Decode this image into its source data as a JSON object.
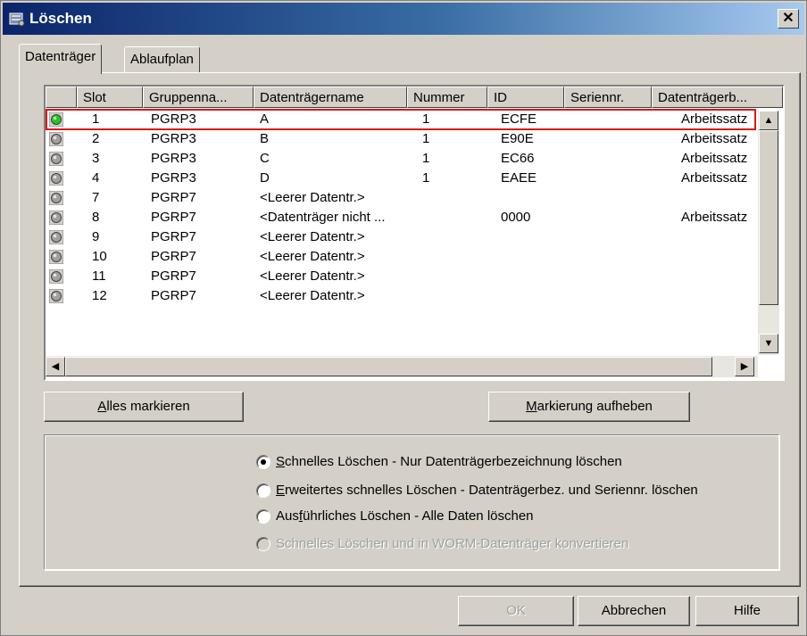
{
  "window": {
    "title": "Löschen",
    "close_glyph": "✕"
  },
  "tabs": [
    {
      "label": "Datenträger",
      "active": true
    },
    {
      "label": "Ablaufplan",
      "active": false
    }
  ],
  "table": {
    "columns": [
      "",
      "Slot",
      "Gruppenna...",
      "Datenträgername",
      "Nummer",
      "ID",
      "Seriennr.",
      "Datenträgerb..."
    ],
    "rows": [
      {
        "status": "green",
        "slot": "1",
        "group": "PGRP3",
        "name": "A",
        "nummer": "1",
        "id": "ECFE",
        "serial": "",
        "desc": "Arbeitssatz"
      },
      {
        "status": "gray",
        "slot": "2",
        "group": "PGRP3",
        "name": "B",
        "nummer": "1",
        "id": "E90E",
        "serial": "",
        "desc": "Arbeitssatz"
      },
      {
        "status": "gray",
        "slot": "3",
        "group": "PGRP3",
        "name": "C",
        "nummer": "1",
        "id": "EC66",
        "serial": "",
        "desc": "Arbeitssatz"
      },
      {
        "status": "gray",
        "slot": "4",
        "group": "PGRP3",
        "name": "D",
        "nummer": "1",
        "id": "EAEE",
        "serial": "",
        "desc": "Arbeitssatz"
      },
      {
        "status": "gray",
        "slot": "7",
        "group": "PGRP7",
        "name": "<Leerer Datentr.>",
        "nummer": "",
        "id": "",
        "serial": "",
        "desc": ""
      },
      {
        "status": "gray",
        "slot": "8",
        "group": "PGRP7",
        "name": "<Datenträger nicht ...",
        "nummer": "",
        "id": "0000",
        "serial": "",
        "desc": "Arbeitssatz"
      },
      {
        "status": "gray",
        "slot": "9",
        "group": "PGRP7",
        "name": "<Leerer Datentr.>",
        "nummer": "",
        "id": "",
        "serial": "",
        "desc": ""
      },
      {
        "status": "gray",
        "slot": "10",
        "group": "PGRP7",
        "name": "<Leerer Datentr.>",
        "nummer": "",
        "id": "",
        "serial": "",
        "desc": ""
      },
      {
        "status": "gray",
        "slot": "11",
        "group": "PGRP7",
        "name": "<Leerer Datentr.>",
        "nummer": "",
        "id": "",
        "serial": "",
        "desc": ""
      },
      {
        "status": "gray",
        "slot": "12",
        "group": "PGRP7",
        "name": "<Leerer Datentr.>",
        "nummer": "",
        "id": "",
        "serial": "",
        "desc": ""
      }
    ]
  },
  "buttons": {
    "select_all": {
      "accel": "A",
      "rest": "lles markieren"
    },
    "deselect": {
      "accel": "M",
      "rest": "arkierung aufheben"
    },
    "ok": "OK",
    "cancel": "Abbrechen",
    "help": "Hilfe"
  },
  "options": [
    {
      "accel": "S",
      "rest": "chnelles Löschen - Nur Datenträgerbezeichnung löschen",
      "checked": true,
      "disabled": false
    },
    {
      "accel": "E",
      "rest": "rweitertes schnelles Löschen - Datenträgerbez. und Seriennr. löschen",
      "checked": false,
      "disabled": false
    },
    {
      "pre": "Aus",
      "accel": "f",
      "rest": "ührliches Löschen - Alle Daten löschen",
      "checked": false,
      "disabled": false
    },
    {
      "pre": "",
      "accel": "",
      "rest": "Schnelles Löschen und in WORM-Datenträger konvertieren",
      "checked": false,
      "disabled": true
    }
  ],
  "colors": {
    "status_active": "#1ec81e",
    "status_idle": "#a0a0a0",
    "selection_outline": "#d81818"
  },
  "icons": {
    "app": "tape-library-icon",
    "scroll_up": "▲",
    "scroll_down": "▼",
    "scroll_left": "◀",
    "scroll_right": "▶"
  }
}
